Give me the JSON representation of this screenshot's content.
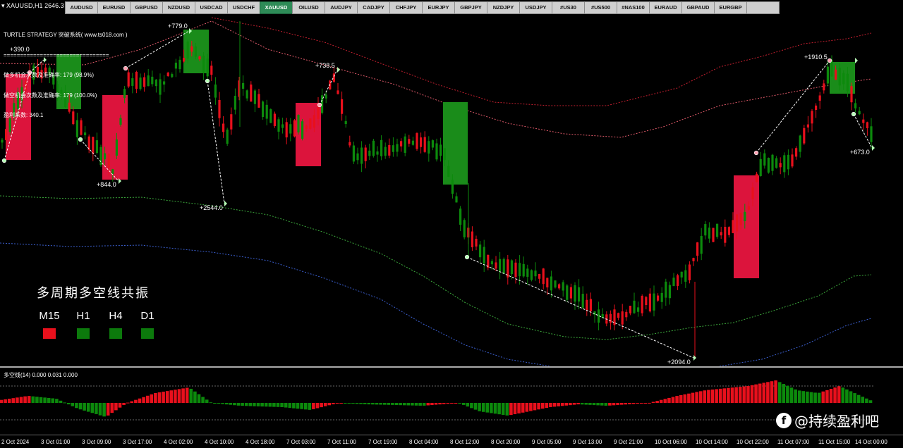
{
  "window": {
    "title": "XAUUSD,H1",
    "price_text": "2646.3"
  },
  "toolbar": {
    "symbols": [
      "AUDUSD",
      "EURUSD",
      "GBPUSD",
      "NZDUSD",
      "USDCAD",
      "USDCHF",
      "XAUUSD",
      "OILUSD",
      "AUDJPY",
      "CADJPY",
      "CHFJPY",
      "EURJPY",
      "GBPJPY",
      "NZDJPY",
      "USDJPY",
      "#US30",
      "#US500",
      "#NAS100",
      "EURAUD",
      "GBPAUD",
      "EURGBP",
      ""
    ],
    "active": "XAUUSD"
  },
  "info_panel": {
    "title": "TURTLE STRATEGY 突破系统( www.ts018.com )",
    "divider": "================================",
    "line1": "做多机会次数及准确率: 179 (98.9%)",
    "line2": "做空机会次数及准确率: 179 (100.0%)",
    "line3": "盈利系数: 340.1"
  },
  "resonance": {
    "title": "多周期多空线共振",
    "timeframes": [
      {
        "label": "M15",
        "color": "#e8101c"
      },
      {
        "label": "H1",
        "color": "#0c7a0c"
      },
      {
        "label": "H4",
        "color": "#0c7a0c"
      },
      {
        "label": "D1",
        "color": "#0c7a0c"
      }
    ]
  },
  "price_labels": [
    {
      "text": "+779.0",
      "color": "#ffffff"
    },
    {
      "text": "+844.0",
      "color": "#ffffff"
    },
    {
      "text": "+2544.0",
      "color": "#ffffff"
    },
    {
      "text": "+738.5",
      "color": "#ffffff"
    },
    {
      "text": "+2094.0",
      "color": "#ffffff"
    },
    {
      "text": "+1910.5",
      "color": "#ffffff"
    },
    {
      "text": "+673.0",
      "color": "#ffffff"
    },
    {
      "text": "+390.0",
      "color": "#ffffff"
    }
  ],
  "indicator": {
    "label": "多空线(14) 0.000 0.031 0.000"
  },
  "time_axis": {
    "ticks": [
      "2 Oct 2024",
      "3 Oct 01:00",
      "3 Oct 09:00",
      "3 Oct 17:00",
      "4 Oct 02:00",
      "4 Oct 10:00",
      "4 Oct 18:00",
      "7 Oct 03:00",
      "7 Oct 11:00",
      "7 Oct 19:00",
      "8 Oct 04:00",
      "8 Oct 12:00",
      "8 Oct 20:00",
      "9 Oct 05:00",
      "9 Oct 13:00",
      "9 Oct 21:00",
      "10 Oct 06:00",
      "10 Oct 14:00",
      "10 Oct 22:00",
      "11 Oct 07:00",
      "11 Oct 15:00",
      "14 Oct 00:00"
    ]
  },
  "watermark": {
    "icon": "f",
    "text": "@持续盈利吧"
  },
  "colors": {
    "bull": "#0c8a0c",
    "bear": "#e8101c",
    "box_green": "#1a8c1a",
    "box_red": "#dc143c",
    "band_red": "#c21f2f",
    "band_pink": "#e05a6a",
    "band_green": "#3caa3c",
    "band_blue": "#3b5fcf"
  }
}
